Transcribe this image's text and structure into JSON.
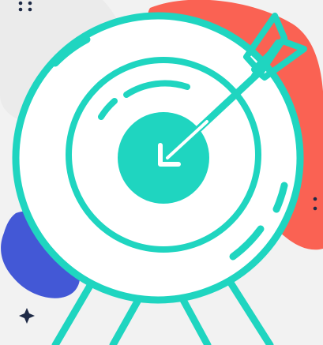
{
  "illustration": {
    "subject": "target-with-arrow-icon",
    "colors": {
      "background": "#f2f2f2",
      "background_shape": "#ebebeb",
      "accent_red": "#fa6253",
      "accent_blue": "#4358d6",
      "target_stroke": "#1fd5c0",
      "target_fill": "#ffffff",
      "sparkle": "#1e2a46"
    }
  }
}
